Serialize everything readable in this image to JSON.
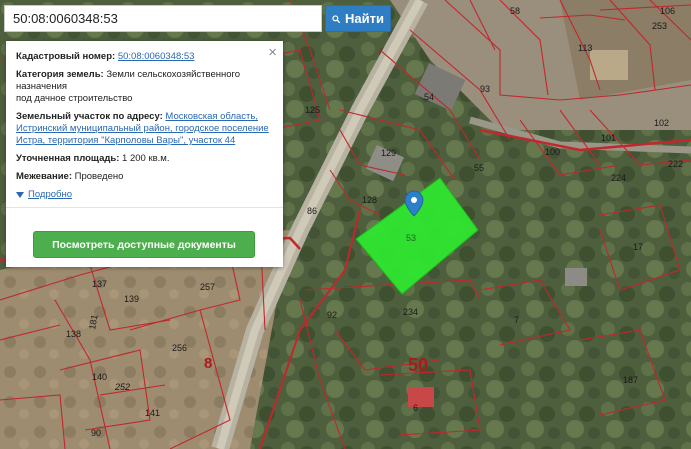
{
  "search": {
    "value": "50:08:0060348:53",
    "button_label": "Найти"
  },
  "popup": {
    "cadastral_label": "Кадастровый номер:",
    "cadastral_value": "50:08:0060348:53",
    "category_label": "Категория земель:",
    "category_value_line1": "Земли сельскохозяйственного назначения",
    "category_value_line2": "под дачное строительство",
    "address_label": "Земельный участок по адресу:",
    "address_value": "Московская область, Истринский муниципальный район, городское поселение Истра, территория \"Карполовы Вары\", участок 44",
    "area_label": "Уточненная площадь:",
    "area_value": "1 200 кв.м.",
    "survey_label": "Межевание:",
    "survey_value": "Проведено",
    "more_label": "Подробно",
    "docs_button_label": "Посмотреть доступные документы",
    "close_label": "×"
  },
  "map": {
    "selected_plot_label": "53",
    "quarter_labels": [
      "50",
      "8"
    ],
    "plot_labels": [
      "58",
      "106",
      "253",
      "113",
      "93",
      "54",
      "55",
      "129",
      "128",
      "125",
      "86",
      "100",
      "101",
      "102",
      "224",
      "222",
      "17",
      "7",
      "187",
      "6",
      "92",
      "234",
      "137",
      "139",
      "257",
      "138",
      "181",
      "256",
      "140",
      "252",
      "141",
      "90"
    ]
  },
  "colors": {
    "selected_plot": "#2ee62e",
    "parcel_border": "#c1272d",
    "button_blue": "#2f7ec4",
    "button_green": "#4cae4c",
    "marker_blue": "#2c7fc9"
  },
  "icons": {
    "search": "search-icon",
    "marker": "map-marker-icon",
    "close": "close-icon",
    "expand": "caret-down-icon"
  }
}
